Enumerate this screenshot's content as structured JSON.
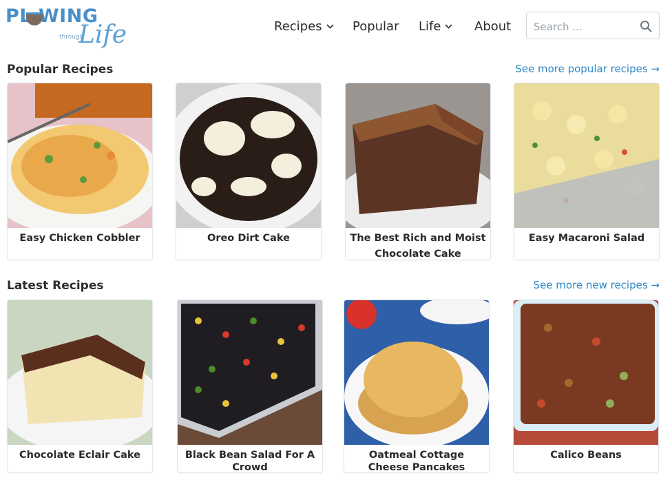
{
  "header": {
    "logo": {
      "main": "PL WING",
      "small": "through",
      "script": "Life"
    },
    "nav": [
      {
        "label": "Recipes",
        "has_dropdown": true
      },
      {
        "label": "Popular",
        "has_dropdown": false
      },
      {
        "label": "Life",
        "has_dropdown": true
      },
      {
        "label": "About",
        "has_dropdown": false
      }
    ],
    "search": {
      "placeholder": "Search ...",
      "icon": "search-icon"
    }
  },
  "popular": {
    "title": "Popular Recipes",
    "see_more": "See more popular recipes →",
    "cards": [
      {
        "title": "Easy Chicken Cobbler"
      },
      {
        "title": "Oreo Dirt Cake"
      },
      {
        "title": "The Best Rich and Moist Chocolate Cake"
      },
      {
        "title": "Easy Macaroni Salad"
      }
    ]
  },
  "latest": {
    "title": "Latest Recipes",
    "see_more": "See more new recipes →",
    "cards": [
      {
        "title": "Chocolate Eclair Cake"
      },
      {
        "title": "Black Bean Salad For A Crowd"
      },
      {
        "title": "Oatmeal Cottage Cheese Pancakes"
      },
      {
        "title": "Calico Beans"
      }
    ]
  },
  "colors": {
    "link": "#2e87c8",
    "logo_blue": "#4a90c8",
    "text": "#2d2d2d"
  }
}
